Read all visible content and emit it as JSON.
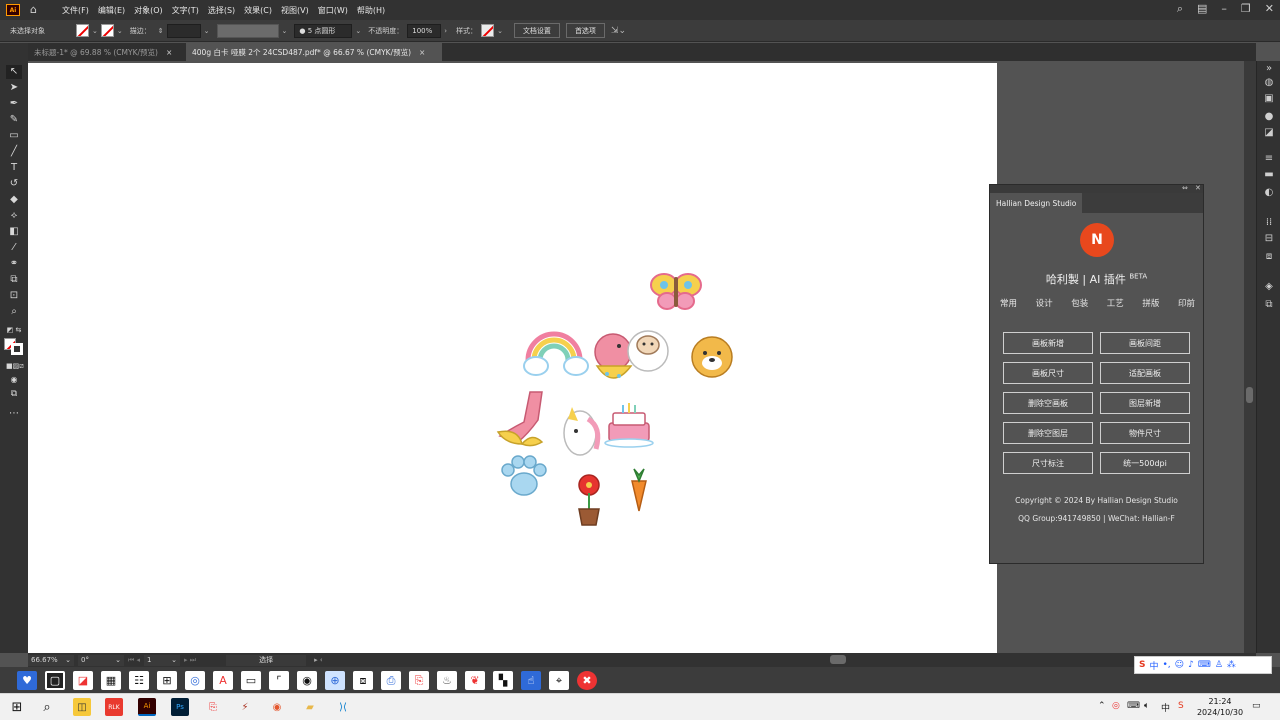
{
  "app": {
    "logo_text": "Ai",
    "home_icon": "home-icon"
  },
  "menu": [
    "文件(F)",
    "编辑(E)",
    "对象(O)",
    "文字(T)",
    "选择(S)",
    "效果(C)",
    "视图(V)",
    "窗口(W)",
    "帮助(H)"
  ],
  "control": {
    "selection_state": "未选择对象",
    "stroke_label": "描边：",
    "brush_value": "● 5 点圆形",
    "opacity_label": "不透明度：",
    "opacity_value": "100%",
    "style_label": "样式：",
    "doc_setup": "文档设置",
    "preferences": "首选项"
  },
  "tabs": [
    {
      "title": "未标题-1* @ 69.88 % (CMYK/预览)",
      "close": "×",
      "active": false
    },
    {
      "title": "400g 白卡 哑膜 2个 24CSD487.pdf* @ 66.67 % (CMYK/预览)",
      "close": "×",
      "active": true
    }
  ],
  "panel": {
    "tab_label": "Hallian Design Studio",
    "logo_text": "N",
    "title": "哈利製 | AI 插件 ",
    "title_badge": "BETA",
    "nav": [
      "常用",
      "设计",
      "包装",
      "工艺",
      "拼版",
      "印前"
    ],
    "buttons": [
      "画板新增",
      "画板间距",
      "画板尺寸",
      "适配画板",
      "删除空画板",
      "图层新增",
      "删除空图层",
      "物件尺寸",
      "尺寸标注",
      "统一500dpi"
    ],
    "copyright": "Copyright © 2024 By Hallian Design Studio",
    "contact": "QQ Group:941749850 | WeChat: Hallian-F",
    "collapse_icon": "collapse-icon",
    "close_icon": "close-icon"
  },
  "status": {
    "zoom": "66.67%",
    "rotation": "0°",
    "artboard_num": "1",
    "tool_name": "选择"
  },
  "ime": {
    "label": "中"
  },
  "clock": {
    "time": "21:24",
    "date": "2024/10/30"
  }
}
